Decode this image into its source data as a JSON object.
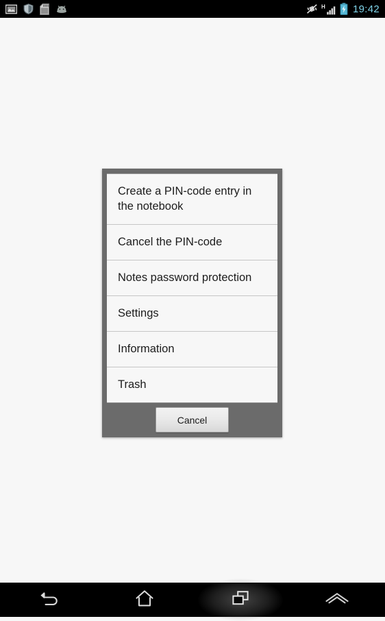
{
  "status_bar": {
    "background": "#000000",
    "left_icons": [
      {
        "name": "gallery-icon",
        "label": "Gallery"
      },
      {
        "name": "shield-icon",
        "label": "Security"
      },
      {
        "name": "sd-card-icon",
        "label": "SD card"
      },
      {
        "name": "android-head-icon",
        "label": "Android"
      }
    ],
    "right_icons": [
      {
        "name": "vibrate-off-icon",
        "label": "Silent / vibrate off"
      },
      {
        "name": "signal-bars-icon",
        "label": "H",
        "network": "H"
      },
      {
        "name": "battery-charging-icon",
        "label": "Battery charging"
      }
    ],
    "clock": "19:42",
    "clock_color": "#7fd3e8"
  },
  "dialog": {
    "frame_color": "#6b6b6b",
    "item_background": "#f7f7f7",
    "items": [
      {
        "label": "Create a PIN-code entry in the notebook",
        "name": "menu-item-create-pin-code-entry"
      },
      {
        "label": "Cancel the PIN-code",
        "name": "menu-item-cancel-pin-code"
      },
      {
        "label": "Notes password protection",
        "name": "menu-item-notes-password-protection"
      },
      {
        "label": "Settings",
        "name": "menu-item-settings"
      },
      {
        "label": "Information",
        "name": "menu-item-information"
      },
      {
        "label": "Trash",
        "name": "menu-item-trash"
      }
    ],
    "cancel_label": "Cancel"
  },
  "nav_bar": {
    "background": "#000000",
    "buttons": [
      {
        "name": "nav-back-button",
        "label": "Back",
        "active": false
      },
      {
        "name": "nav-home-button",
        "label": "Home",
        "active": false
      },
      {
        "name": "nav-recents-button",
        "label": "Recent apps",
        "active": true
      },
      {
        "name": "nav-menu-up-button",
        "label": "Menu",
        "active": false
      }
    ]
  },
  "page": {
    "background": "#f7f7f7"
  }
}
